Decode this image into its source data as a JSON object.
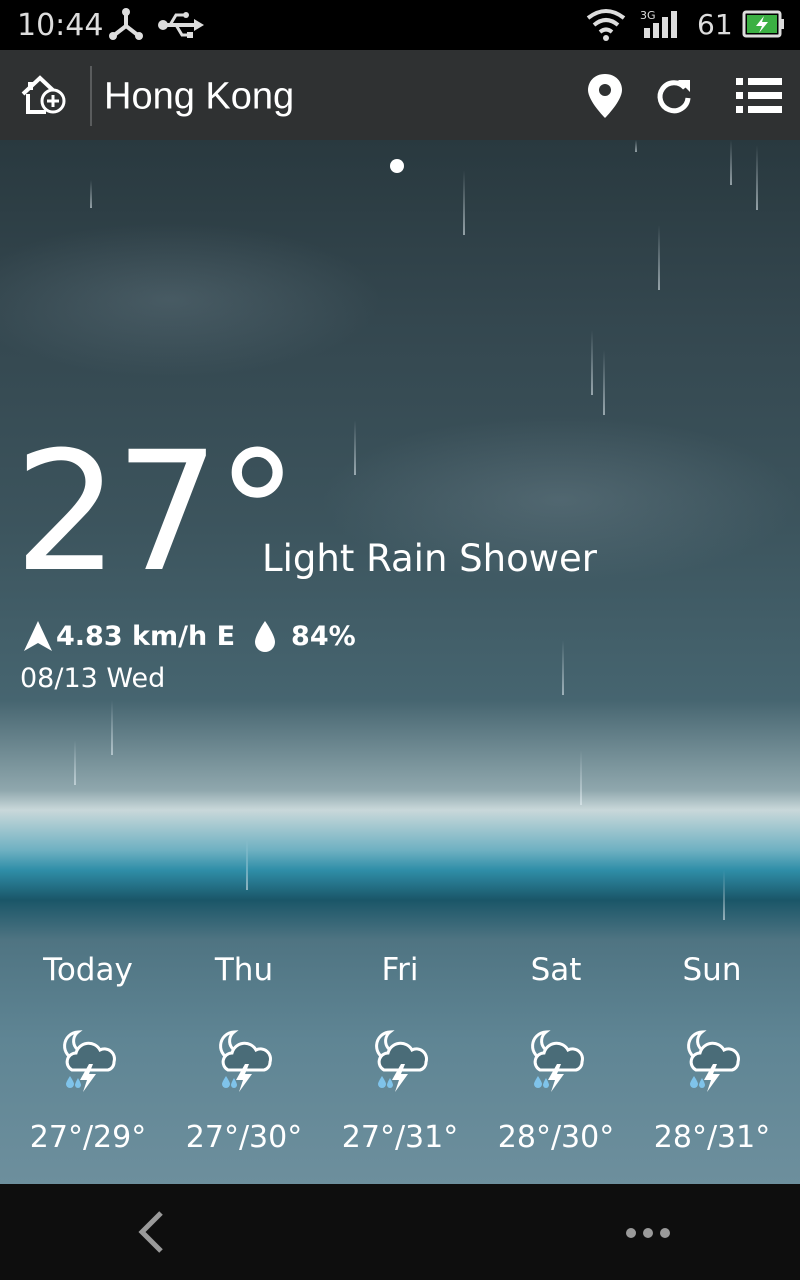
{
  "status_bar": {
    "time": "10:44",
    "battery": "61",
    "network": "3G",
    "icons": [
      "network-share-icon",
      "usb-icon",
      "wifi-icon",
      "signal-icon",
      "battery-charging-icon"
    ]
  },
  "app_bar": {
    "city": "Hong Kong",
    "add_city_icon": "add-city-icon",
    "location_icon": "location-pin-icon",
    "refresh_icon": "refresh-icon",
    "menu_icon": "list-menu-icon"
  },
  "current": {
    "temperature": "27°",
    "condition": "Light Rain Shower",
    "wind": "4.83 km/h E",
    "humidity": "84%",
    "date": "08/13 Wed"
  },
  "forecast": [
    {
      "day": "Today",
      "temps": "27°/29°",
      "icon": "night-thunder-rain-icon"
    },
    {
      "day": "Thu",
      "temps": "27°/30°",
      "icon": "night-thunder-rain-icon"
    },
    {
      "day": "Fri",
      "temps": "27°/31°",
      "icon": "night-thunder-rain-icon"
    },
    {
      "day": "Sat",
      "temps": "28°/30°",
      "icon": "night-thunder-rain-icon"
    },
    {
      "day": "Sun",
      "temps": "28°/31°",
      "icon": "night-thunder-rain-icon"
    }
  ],
  "nav_bar": {
    "back_icon": "back-icon",
    "overflow_icon": "overflow-menu-icon"
  },
  "colors": {
    "status_bar": "#000000",
    "app_bar": "#2f3132",
    "nav_bar": "#0e0e0e",
    "bolt": "#ffffff",
    "raindrop": "#7fc3ea"
  }
}
